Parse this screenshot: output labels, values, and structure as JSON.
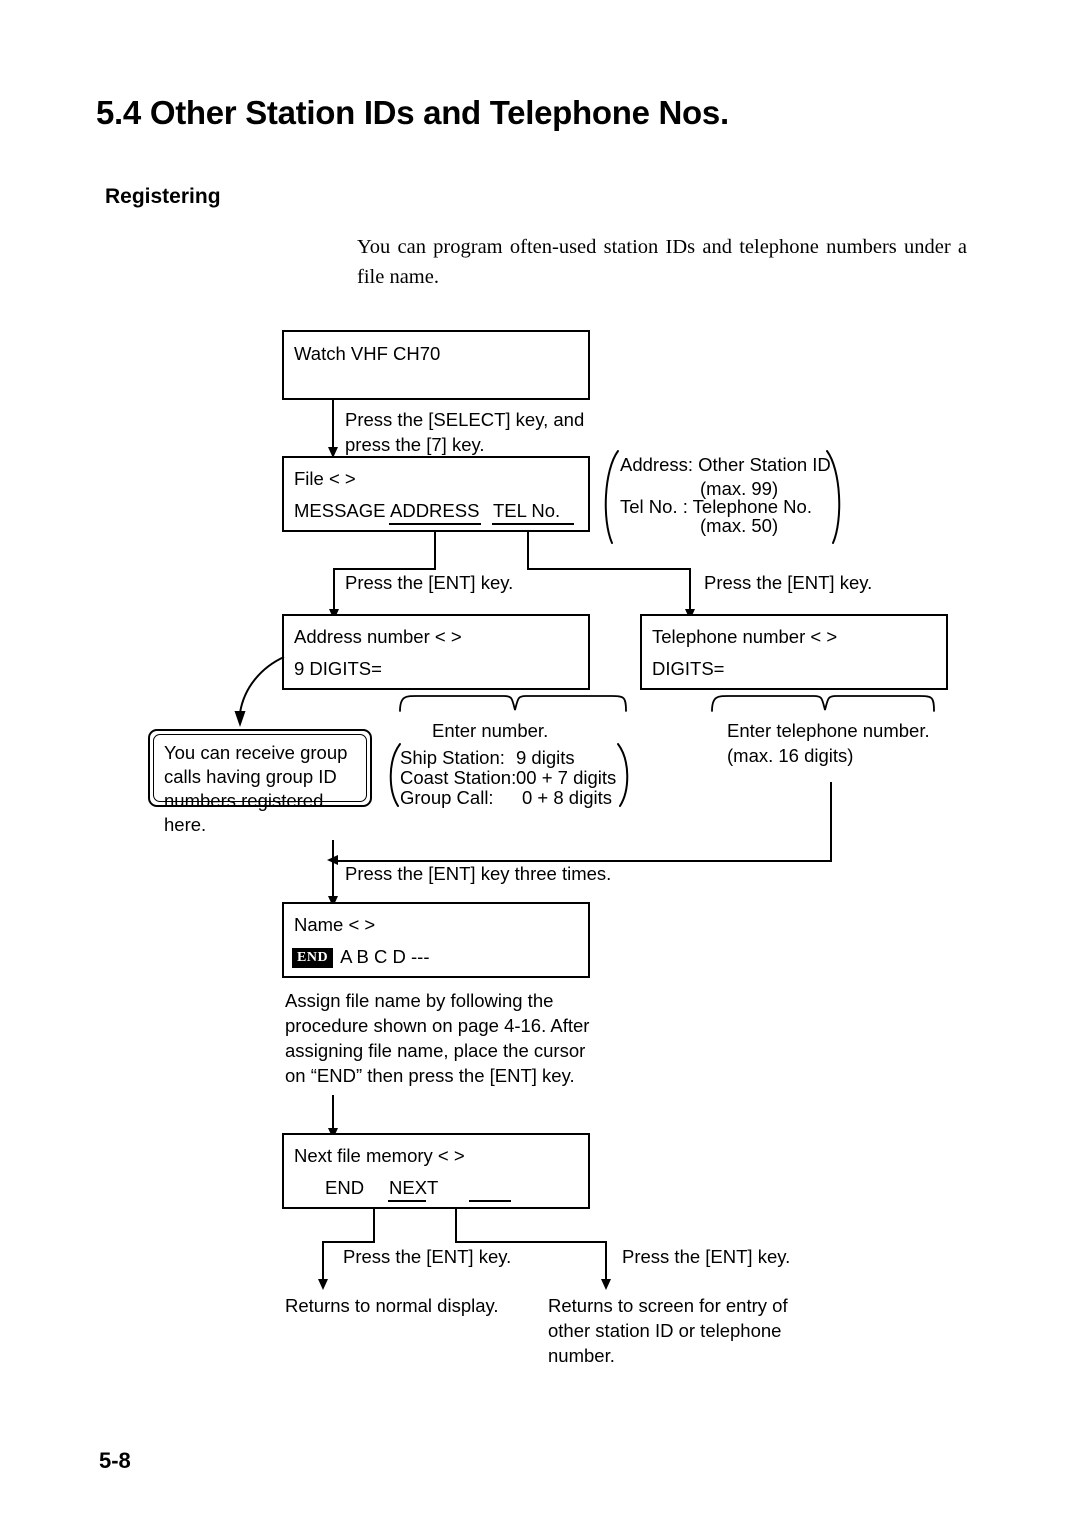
{
  "document": {
    "section_number_title": "5.4 Other Station IDs and Telephone Nos.",
    "subsection_title": "Registering",
    "intro_paragraph": "You can program often-used station IDs and telephone numbers under a file name.",
    "page_folio": "5-8"
  },
  "flow": {
    "watch_box": {
      "line1": "Watch VHF CH70"
    },
    "step_select": "Press the [SELECT] key, and\npress the [7] key.",
    "file_box": {
      "line1": "File <                >",
      "item_message": "MESSAGE",
      "item_address": "ADDRESS",
      "item_tel": "TEL No."
    },
    "file_annotation": {
      "line1": "Address: Other Station ID",
      "line2": "(max. 99)",
      "line3": "Tel No.  : Telephone No.",
      "line4": "(max. 50)"
    },
    "step_ent_left": "Press the [ENT] key.",
    "step_ent_right": "Press the [ENT] key.",
    "address_box": {
      "line1": "Address number <      >",
      "line2": "9 DIGITS="
    },
    "telephone_box": {
      "line1": "Telephone number <     >",
      "line2": "DIGITS="
    },
    "group_callout": "You can receive group\ncalls having group ID\nnumbers registered here.",
    "enter_number_label": "Enter number.",
    "enter_number_detail": {
      "row1_label": "Ship Station:",
      "row1_value": "9 digits",
      "row2_label": "Coast Station:",
      "row2_value": "00 + 7 digits",
      "row3_label": "Group Call:",
      "row3_value": "0 + 8 digits"
    },
    "enter_telephone_label": "Enter telephone number.\n(max. 16 digits)",
    "step_ent_three_times": "Press the [ENT] key three times.",
    "name_box": {
      "line1": "Name <              >",
      "badge": "END",
      "line2_rest": "A B C D ---"
    },
    "name_instruction": "Assign file name by following the\nprocedure shown on page 4-16. After\nassigning file name, place the cursor\non “END” then press the [ENT] key.",
    "next_file_box": {
      "line1": "Next file memory <   >",
      "item_end": "END",
      "item_next": "NEXT"
    },
    "step_ent_bottom_left": "Press the [ENT] key.",
    "step_ent_bottom_right": "Press the [ENT] key.",
    "result_left": "Returns to normal display.",
    "result_right": "Returns to screen for entry of\nother station ID or telephone\nnumber."
  },
  "colors": {
    "ink": "#000000",
    "paper": "#ffffff"
  }
}
